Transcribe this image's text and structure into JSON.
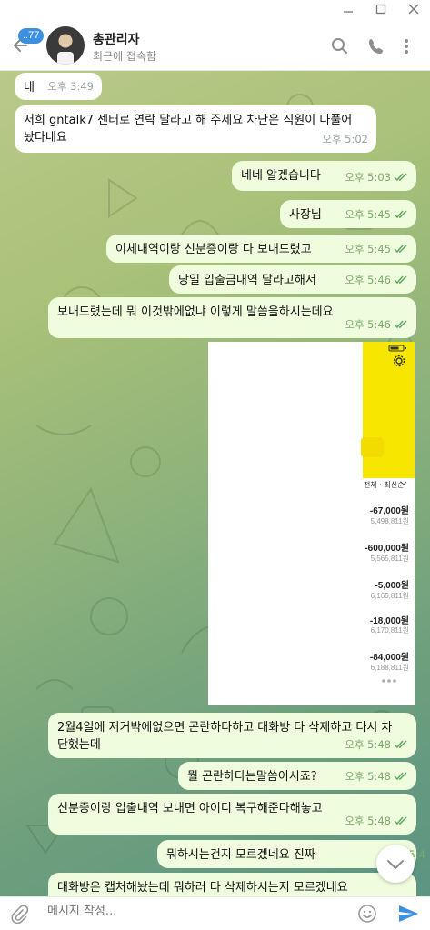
{
  "header": {
    "unread_badge": "..77",
    "contact_name": "총관리자",
    "contact_status": "최근에 접속함"
  },
  "messages": [
    {
      "id": 0,
      "dir": "in",
      "text": "네",
      "time": "오후 3:49"
    },
    {
      "id": 1,
      "dir": "in",
      "text": "저희 gntalk7 센터로 연락 달라고 해 주세요 차단은 직원이 다풀어놨다네요",
      "time": "오후 5:02"
    },
    {
      "id": 2,
      "dir": "out",
      "text": "네네 알겠습니다",
      "time": "오후 5:03"
    },
    {
      "id": 3,
      "dir": "out",
      "text": "사장님",
      "time": "오후 5:45"
    },
    {
      "id": 4,
      "dir": "out",
      "text": "이체내역이랑 신분증이랑 다 보내드렸고",
      "time": "오후 5:45"
    },
    {
      "id": 5,
      "dir": "out",
      "text": "당일 입출금내역 달라고해서",
      "time": "오후 5:46"
    },
    {
      "id": 6,
      "dir": "out",
      "text": "보내드렸는데 뭐 이것밖에없냐 이렇게 말씀을하시는데요",
      "time": "오후 5:46"
    },
    {
      "id": 7,
      "dir": "out",
      "text": "2월4일에 저거밖에없으면 곤란하다하고 대화방 다 삭제하고 다시 차단했는데",
      "time": "오후 5:48"
    },
    {
      "id": 8,
      "dir": "out",
      "text": "뭘 곤란하다는말씀이시죠?",
      "time": "오후 5:48"
    },
    {
      "id": 9,
      "dir": "out",
      "text": "신분증이랑 입출내역 보내면 아이디 복구해준다해놓고",
      "time": "오후 5:48"
    },
    {
      "id": 10,
      "dir": "out",
      "text": "뭐하시는건지 모르겠네요 진짜",
      "time": "오후 5:4"
    },
    {
      "id": 11,
      "dir": "out",
      "text": "대화방은 캡처해놨는데 뭐하러 다 삭제하시는지 모르겠네요",
      "time": ""
    }
  ],
  "screenshot": {
    "filter_label": "전체 · 최신순",
    "rows": [
      {
        "amount": "-67,000원",
        "balance": "5,498,811원"
      },
      {
        "amount": "-600,000원",
        "balance": "5,565,811원"
      },
      {
        "amount": "-5,000원",
        "balance": "6,165,811원"
      },
      {
        "amount": "-18,000원",
        "balance": "6,170,811원"
      },
      {
        "amount": "-84,000원",
        "balance": "6,188,811원"
      }
    ]
  },
  "input": {
    "placeholder": "메시지 작성..."
  },
  "colors": {
    "incoming_bubble": "#ffffff",
    "outgoing_bubble": "#effdde",
    "accent": "#3d8fe0",
    "check": "#5fa862"
  },
  "icons": [
    "back-arrow-icon",
    "search-icon",
    "phone-icon",
    "more-vertical-icon",
    "attach-icon",
    "emoji-icon",
    "send-icon",
    "chevron-down-icon",
    "double-check-icon",
    "settings-gear-icon"
  ]
}
